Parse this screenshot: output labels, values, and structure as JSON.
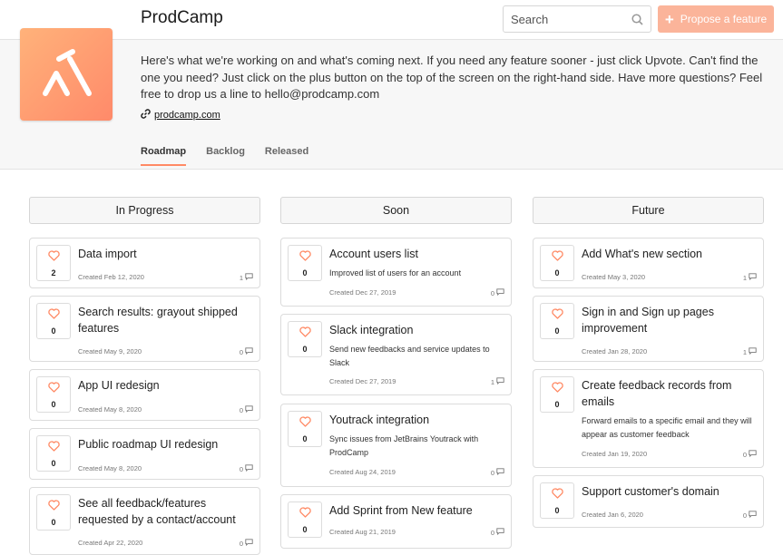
{
  "header": {
    "app_title": "ProdCamp",
    "search_placeholder": "Search",
    "propose_label": "Propose a feature",
    "description": "Here's what we're working on and what's coming next. If you need any feature sooner - just click Upvote. Can't find the one you need? Just click on the plus button on the top of the screen on the right-hand side. Have more questions? Feel free to drop us a line to hello@prodcamp.com",
    "link_text": "prodcamp.com",
    "tabs": [
      {
        "label": "Roadmap",
        "active": true
      },
      {
        "label": "Backlog",
        "active": false
      },
      {
        "label": "Released",
        "active": false
      }
    ]
  },
  "colors": {
    "accent": "#ff8a65",
    "propose_bg": "#fbb49a"
  },
  "columns": [
    {
      "title": "In Progress",
      "cards": [
        {
          "title": "Data import",
          "votes": "2",
          "date": "Created Feb 12, 2020",
          "comments": "1"
        },
        {
          "title": "Search results: grayout shipped features",
          "votes": "0",
          "date": "Created May 9, 2020",
          "comments": "0"
        },
        {
          "title": "App UI redesign",
          "votes": "0",
          "date": "Created May 8, 2020",
          "comments": "0"
        },
        {
          "title": "Public roadmap UI redesign",
          "votes": "0",
          "date": "Created May 8, 2020",
          "comments": "0"
        },
        {
          "title": "See all feedback/features requested by a contact/account",
          "votes": "0",
          "date": "Created Apr 22, 2020",
          "comments": "0"
        }
      ]
    },
    {
      "title": "Soon",
      "cards": [
        {
          "title": "Account users list",
          "votes": "0",
          "description": "Improved list of users for an account",
          "date": "Created Dec 27, 2019",
          "comments": "0"
        },
        {
          "title": "Slack integration",
          "votes": "0",
          "description": "Send new feedbacks and service updates to Slack",
          "date": "Created Dec 27, 2019",
          "comments": "1"
        },
        {
          "title": "Youtrack integration",
          "votes": "0",
          "description": "Sync issues from JetBrains Youtrack with ProdCamp",
          "date": "Created Aug 24, 2019",
          "comments": "0"
        },
        {
          "title": "Add Sprint from New feature",
          "votes": "0",
          "date": "Created Aug 21, 2019",
          "comments": "0"
        }
      ]
    },
    {
      "title": "Future",
      "cards": [
        {
          "title": "Add What's new section",
          "votes": "0",
          "date": "Created May 3, 2020",
          "comments": "1"
        },
        {
          "title": "Sign in and Sign up pages improvement",
          "votes": "0",
          "date": "Created Jan 28, 2020",
          "comments": "1"
        },
        {
          "title": "Create feedback records from emails",
          "votes": "0",
          "description": "Forward emails to a specific email and they will appear as customer feedback",
          "date": "Created Jan 19, 2020",
          "comments": "0"
        },
        {
          "title": "Support customer's domain",
          "votes": "0",
          "date": "Created Jan 6, 2020",
          "comments": "0"
        }
      ]
    }
  ]
}
